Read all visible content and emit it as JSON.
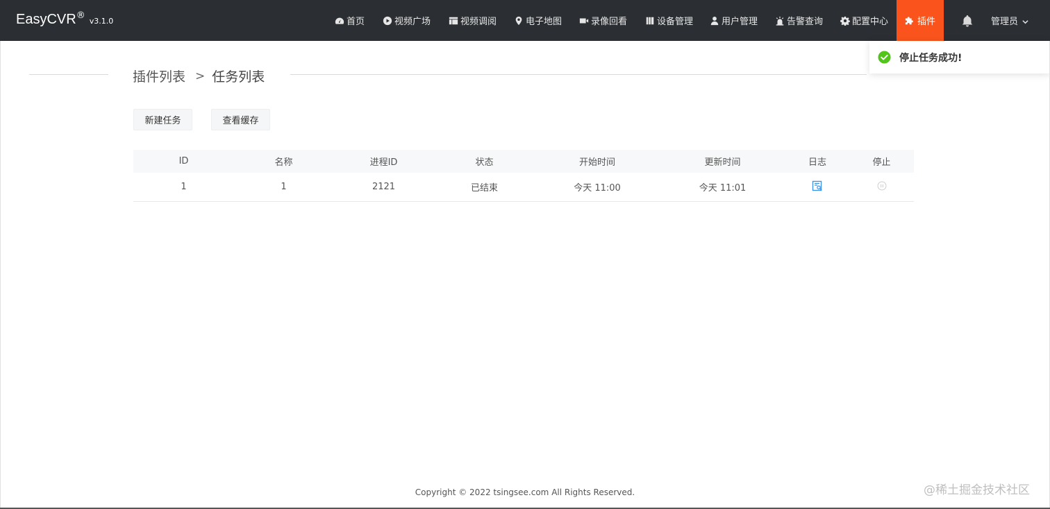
{
  "brand": {
    "name": "EasyCVR",
    "reg": "®",
    "version": "v3.1.0"
  },
  "nav": {
    "items": [
      {
        "label": "首页",
        "icon": "dashboard-icon"
      },
      {
        "label": "视频广场",
        "icon": "play-circle-icon"
      },
      {
        "label": "视频调阅",
        "icon": "grid-layout-icon"
      },
      {
        "label": "电子地图",
        "icon": "map-pin-icon"
      },
      {
        "label": "录像回看",
        "icon": "video-camera-icon"
      },
      {
        "label": "设备管理",
        "icon": "device-icon"
      },
      {
        "label": "用户管理",
        "icon": "user-icon"
      },
      {
        "label": "告警查询",
        "icon": "alarm-icon"
      },
      {
        "label": "配置中心",
        "icon": "gear-icon"
      },
      {
        "label": "插件",
        "icon": "puzzle-icon",
        "active": true
      }
    ],
    "user": "管理员",
    "active_color": "#fa541c",
    "bar_color": "#2b2f33"
  },
  "toast": {
    "message": "停止任务成功!",
    "icon": "check-circle-icon",
    "color": "#52c41a"
  },
  "breadcrumb": {
    "parent": "插件列表",
    "separator": ">",
    "current": "任务列表"
  },
  "toolbar": {
    "new_task": "新建任务",
    "view_cache": "查看缓存"
  },
  "table": {
    "columns": [
      "ID",
      "名称",
      "进程ID",
      "状态",
      "开始时间",
      "更新时间",
      "日志",
      "停止"
    ],
    "rows": [
      {
        "id": "1",
        "name": "1",
        "pid": "2121",
        "status": "已结束",
        "start": "今天 11:00",
        "update": "今天 11:01",
        "log_icon": "log-view-icon",
        "stop_icon": "pause-circle-icon"
      }
    ]
  },
  "footer": {
    "copyright": "Copyright © 2022 tsingsee.com All Rights Reserved."
  },
  "watermark": "@稀土掘金技术社区"
}
